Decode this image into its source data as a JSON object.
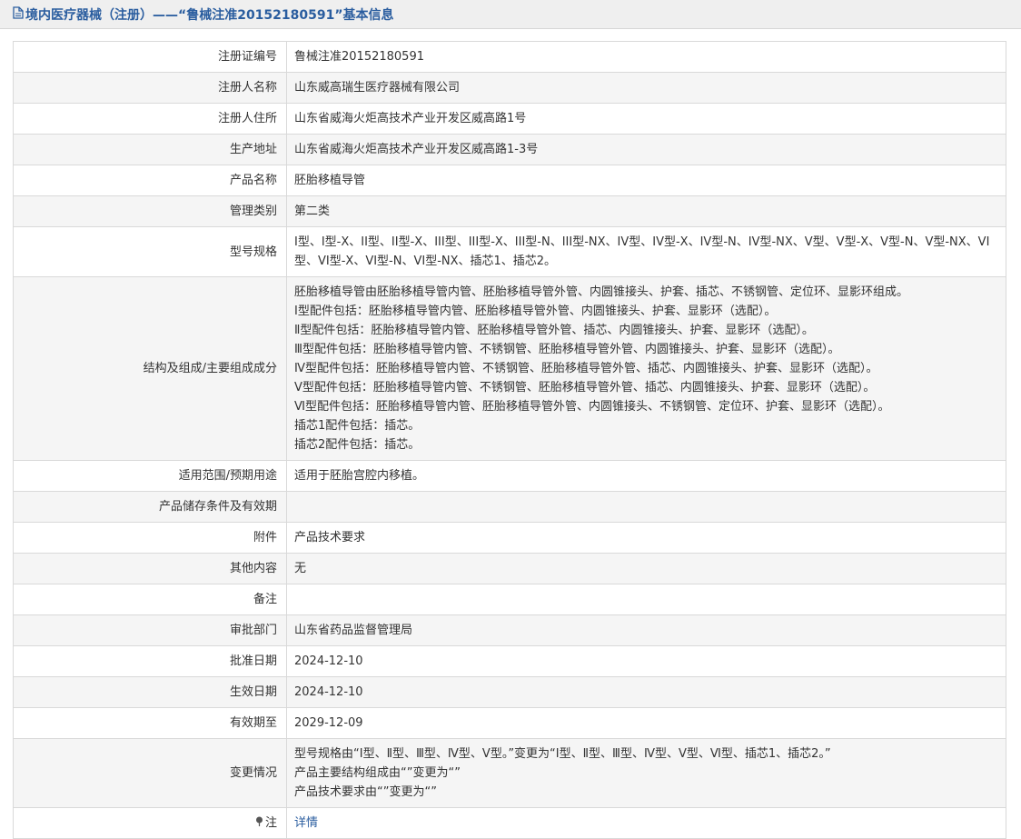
{
  "header": {
    "title": "境内医疗器械（注册）——“鲁械注准20152180591”基本信息"
  },
  "rows": [
    {
      "label": "注册证编号",
      "value": "鲁械注准20152180591"
    },
    {
      "label": "注册人名称",
      "value": "山东威高瑞生医疗器械有限公司"
    },
    {
      "label": "注册人住所",
      "value": "山东省威海火炬高技术产业开发区威高路1号"
    },
    {
      "label": "生产地址",
      "value": "山东省威海火炬高技术产业开发区威高路1-3号"
    },
    {
      "label": "产品名称",
      "value": "胚胎移植导管"
    },
    {
      "label": "管理类别",
      "value": "第二类"
    },
    {
      "label": "型号规格",
      "value": "I型、I型-X、II型、II型-X、III型、III型-X、III型-N、III型-NX、IV型、IV型-X、IV型-N、IV型-NX、V型、V型-X、V型-N、V型-NX、VI型、VI型-X、VI型-N、VI型-NX、插芯1、插芯2。"
    },
    {
      "label": "结构及组成/主要组成成分",
      "lines": [
        "胚胎移植导管由胚胎移植导管内管、胚胎移植导管外管、内圆锥接头、护套、插芯、不锈钢管、定位环、显影环组成。",
        "Ⅰ型配件包括：胚胎移植导管内管、胚胎移植导管外管、内圆锥接头、护套、显影环（选配）。",
        "Ⅱ型配件包括：胚胎移植导管内管、胚胎移植导管外管、插芯、内圆锥接头、护套、显影环（选配）。",
        "Ⅲ型配件包括：胚胎移植导管内管、不锈钢管、胚胎移植导管外管、内圆锥接头、护套、显影环（选配）。",
        "Ⅳ型配件包括：胚胎移植导管内管、不锈钢管、胚胎移植导管外管、插芯、内圆锥接头、护套、显影环（选配）。",
        "Ⅴ型配件包括：胚胎移植导管内管、不锈钢管、胚胎移植导管外管、插芯、内圆锥接头、护套、显影环（选配）。",
        "Ⅵ型配件包括：胚胎移植导管内管、胚胎移植导管外管、内圆锥接头、不锈钢管、定位环、护套、显影环（选配）。",
        "插芯1配件包括：插芯。",
        "插芯2配件包括：插芯。"
      ]
    },
    {
      "label": "适用范围/预期用途",
      "value": "适用于胚胎宫腔内移植。"
    },
    {
      "label": "产品储存条件及有效期",
      "value": ""
    },
    {
      "label": "附件",
      "value": "产品技术要求"
    },
    {
      "label": "其他内容",
      "value": "无"
    },
    {
      "label": "备注",
      "value": ""
    },
    {
      "label": "审批部门",
      "value": "山东省药品监督管理局"
    },
    {
      "label": "批准日期",
      "value": "2024-12-10"
    },
    {
      "label": "生效日期",
      "value": "2024-12-10"
    },
    {
      "label": "有效期至",
      "value": "2029-12-09"
    },
    {
      "label": "变更情况",
      "lines": [
        "型号规格由“Ⅰ型、Ⅱ型、Ⅲ型、Ⅳ型、Ⅴ型。”变更为“Ⅰ型、Ⅱ型、Ⅲ型、Ⅳ型、Ⅴ型、Ⅵ型、插芯1、插芯2。”",
        "产品主要结构组成由“”变更为“”",
        "产品技术要求由“”变更为“”"
      ]
    },
    {
      "label": "注",
      "link": "详情"
    }
  ]
}
